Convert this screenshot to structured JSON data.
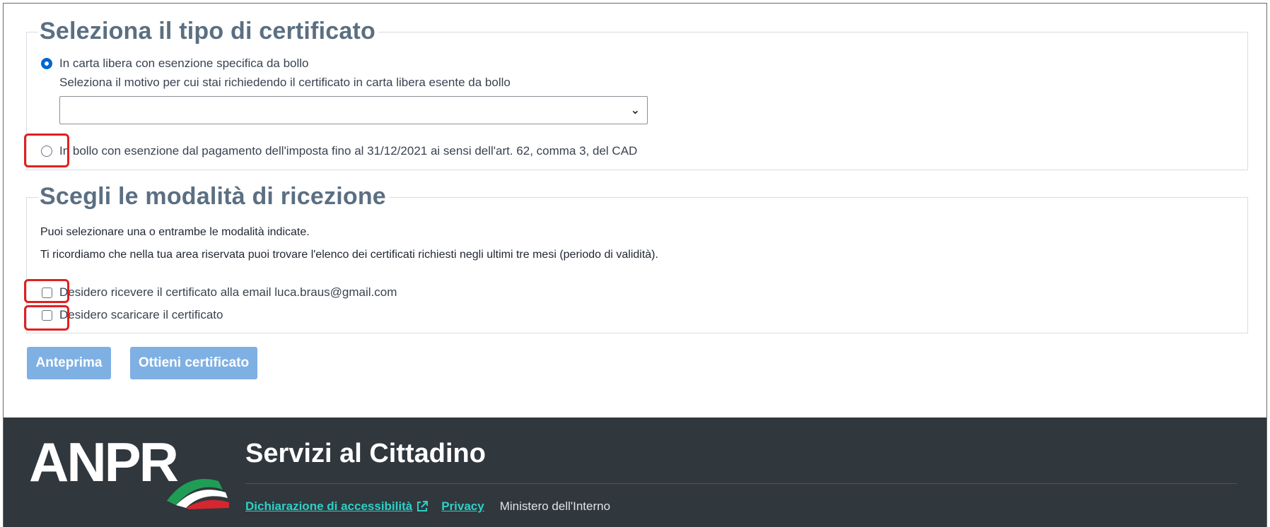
{
  "certificate_section": {
    "title": "Seleziona il tipo di certificato",
    "option_carta_libera": "In carta libera con esenzione specifica da bollo",
    "motivo_hint": "Seleziona il motivo per cui stai richiedendo il certificato in carta libera esente da bollo",
    "motivo_select_value": "",
    "option_bollo": "In bollo con esenzione dal pagamento dell'imposta fino al 31/12/2021 ai sensi dell'art. 62, comma 3, del CAD"
  },
  "reception_section": {
    "title": "Scegli le modalità di ricezione",
    "info_line_1": "Puoi selezionare una o entrambe le modalità indicate.",
    "info_line_2": "Ti ricordiamo che nella tua area riservata puoi trovare l'elenco dei certificati richiesti negli ultimi tre mesi (periodo di validità).",
    "option_email": "Desidero ricevere il certificato alla email luca.braus@gmail.com",
    "option_download": "Desidero scaricare il certificato"
  },
  "actions": {
    "preview_label": "Anteprima",
    "obtain_label": "Ottieni certificato"
  },
  "footer": {
    "logo_text": "ANPR",
    "title": "Servizi al Cittadino",
    "accessibility_link": "Dichiarazione di accessibilità",
    "privacy_link": "Privacy",
    "ministry_text": "Ministero dell'Interno"
  },
  "colors": {
    "accent": "#0066cc",
    "button_disabled": "#7fb0e3",
    "highlight": "#e02020",
    "footer_bg": "#30373d",
    "footer_link": "#2ed0c4"
  }
}
